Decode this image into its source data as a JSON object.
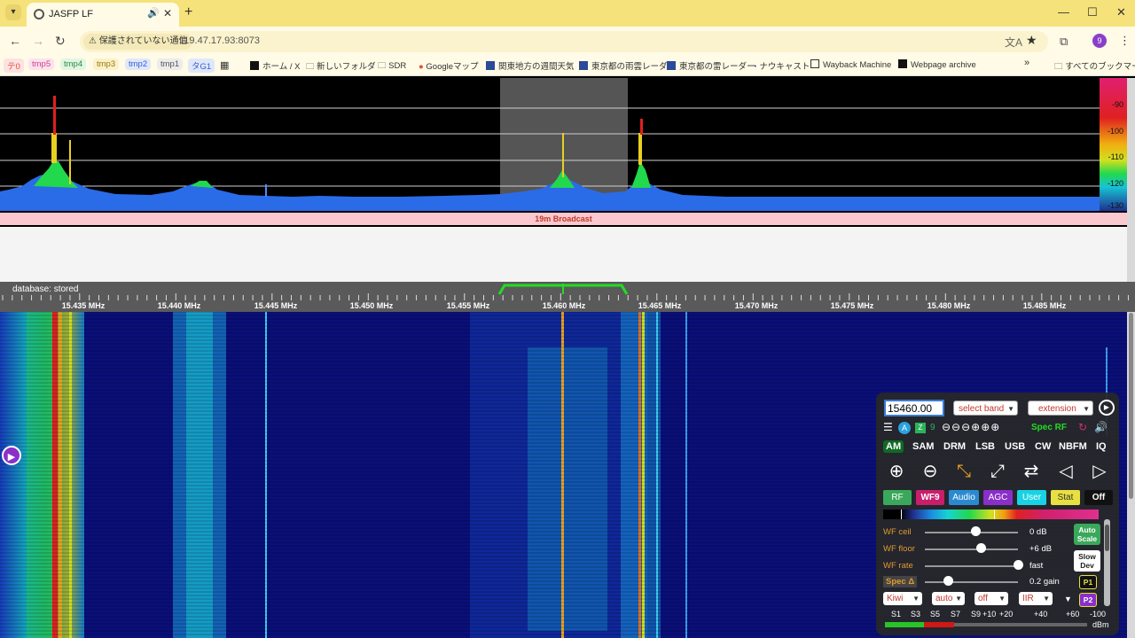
{
  "browser": {
    "tab_title": "JASFP LF",
    "tab_audio_icon": "speaker-icon",
    "tab_close": "✕",
    "new_tab": "+",
    "security_label": "保護されていない通信",
    "url": "119.47.17.93:8073"
  },
  "bookmarks": [
    {
      "label": "テ0",
      "color": "#e74c3c",
      "bg": "#fde2e2"
    },
    {
      "label": "tmp5",
      "color": "#d03f8a",
      "bg": "#fbe2ef"
    },
    {
      "label": "tmp4",
      "color": "#2e8b3c",
      "bg": "#e0f5e3"
    },
    {
      "label": "tmp3",
      "color": "#9a7a10",
      "bg": "#fbf0c8"
    },
    {
      "label": "tmp2",
      "color": "#3a5fcd",
      "bg": "#dfe7fb"
    },
    {
      "label": "tmp1",
      "color": "#555555",
      "bg": "#ececec"
    },
    {
      "label": "タG1",
      "color": "#3a5fcd",
      "bg": "#dfe7fb"
    },
    {
      "label": "ホーム / X"
    },
    {
      "label": "新しいフォルダ"
    },
    {
      "label": "SDR"
    },
    {
      "label": "Googleマップ"
    },
    {
      "label": "関東地方の週間天気"
    },
    {
      "label": "東京都の雨雲レーダ"
    },
    {
      "label": "東京都の雷レーダー"
    },
    {
      "label": "ナウキャスト"
    },
    {
      "label": "Wayback Machine"
    },
    {
      "label": "Webpage archive"
    },
    {
      "label": "すべてのブックマーク"
    }
  ],
  "spectrum": {
    "db_labels": [
      "-90",
      "-100",
      "-110",
      "-120",
      "-130"
    ],
    "band_label": "19m Broadcast"
  },
  "scale": {
    "status": "database: stored",
    "freq_labels": [
      "15.435 MHz",
      "15.440 MHz",
      "15.445 MHz",
      "15.450 MHz",
      "15.455 MHz",
      "15.460 MHz",
      "15.465 MHz",
      "15.470 MHz",
      "15.475 MHz",
      "15.480 MHz",
      "15.485 MHz"
    ]
  },
  "panel": {
    "frequency": "15460.00",
    "band_select": "select band",
    "extension_select": "extension",
    "row2_value": "9",
    "spec_rf": "Spec RF",
    "modes": [
      "AM",
      "SAM",
      "DRM",
      "LSB",
      "USB",
      "CW",
      "NBFM",
      "IQ"
    ],
    "tabs": [
      "RF",
      "WF9",
      "Audio",
      "AGC",
      "User",
      "Stat",
      "Off"
    ],
    "sliders": [
      {
        "label": "WF ceil",
        "value": "0 dB",
        "level": 0.55
      },
      {
        "label": "WF floor",
        "value": "+6 dB",
        "level": 0.6
      },
      {
        "label": "WF rate",
        "value": "fast",
        "level": 1.0
      },
      {
        "label": "Spec Δ",
        "value": "0.2 gain",
        "level": 0.25
      }
    ],
    "auto_scale": [
      "Auto",
      "Scale"
    ],
    "slow_dev": [
      "Slow",
      "Dev"
    ],
    "p1": "P1",
    "p2": "P2",
    "bottom_selects": [
      "Kiwi",
      "auto",
      "off",
      "IIR"
    ],
    "smeter_labels": [
      "S1",
      "S3",
      "S5",
      "S7",
      "S9",
      "+10",
      "+20",
      "+40",
      "+60",
      "-100"
    ],
    "smeter_unit": "dBm"
  }
}
